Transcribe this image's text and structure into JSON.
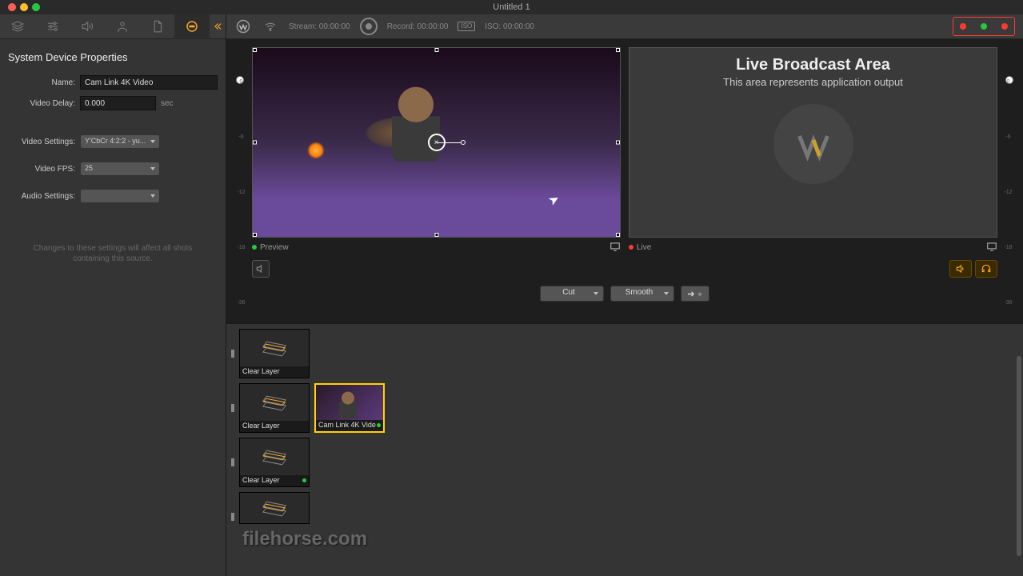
{
  "window": {
    "title": "Untitled 1"
  },
  "leftPanel": {
    "title": "System Device Properties",
    "rows": {
      "name": {
        "label": "Name:",
        "value": "Cam Link 4K Video"
      },
      "delay": {
        "label": "Video Delay:",
        "value": "0.000",
        "suffix": "sec"
      },
      "vsettings": {
        "label": "Video Settings:",
        "value": "Y'CbCr 4:2:2 - yu..."
      },
      "fps": {
        "label": "Video FPS:",
        "value": "25"
      },
      "asettings": {
        "label": "Audio Settings:",
        "value": ""
      }
    },
    "hint": "Changes to these settings will affect all shots containing this source."
  },
  "toolbar": {
    "stream": {
      "label": "Stream:",
      "time": "00:00:00"
    },
    "record": {
      "label": "Record:",
      "time": "00:00:00"
    },
    "iso": {
      "label": "ISO:",
      "badge": "ISO",
      "time": "00:00:00"
    }
  },
  "meter": {
    "ticks": [
      "0",
      "-6",
      "-12",
      "-18",
      "-36"
    ]
  },
  "preview": {
    "label": "Preview"
  },
  "live": {
    "label": "Live",
    "title": "Live Broadcast Area",
    "sub": "This area represents application output"
  },
  "transition": {
    "cut": "Cut",
    "smooth": "Smooth",
    "go": "➔ ∘"
  },
  "layers": {
    "clear": "Clear Layer",
    "camlink": "Cam Link 4K Vide"
  },
  "watermark": "filehorse.com"
}
